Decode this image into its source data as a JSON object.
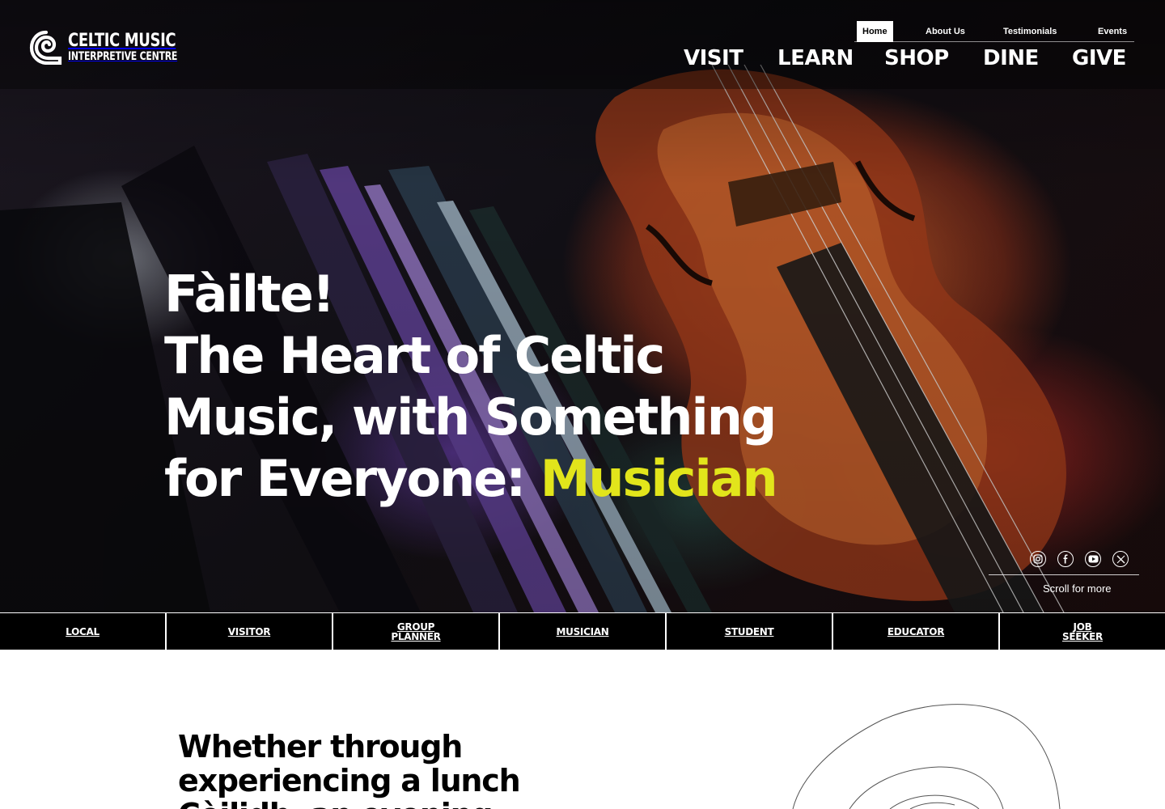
{
  "brand": {
    "line1": "CELTIC MUSIC",
    "line2": "INTERPRETIVE CENTRE"
  },
  "top_nav": [
    {
      "label": "Home",
      "active": true
    },
    {
      "label": "About Us",
      "active": false
    },
    {
      "label": "Testimonials",
      "active": false
    },
    {
      "label": "Events",
      "active": false
    }
  ],
  "main_nav": [
    "VISIT",
    "LEARN",
    "SHOP",
    "DINE",
    "GIVE"
  ],
  "hero": {
    "greeting": "Fàilte!",
    "line2": "The Heart of Celtic",
    "line3": "Music, with Something",
    "line4_prefix": "for Everyone: ",
    "highlight_word": "Musician",
    "highlight_color": "#e2e51b"
  },
  "social_icons": [
    "instagram-icon",
    "facebook-icon",
    "youtube-icon",
    "x-icon"
  ],
  "scroll_label": "Scroll for more",
  "audience_tabs": [
    "LOCAL",
    "VISITOR",
    "GROUP\nPLANNER",
    "MUSICIAN",
    "STUDENT",
    "EDUCATOR",
    "JOB\nSEEKER"
  ],
  "intro": {
    "line1": "Whether through",
    "line2": "experiencing a lunch",
    "line3": "Cèilidh, an evening"
  }
}
